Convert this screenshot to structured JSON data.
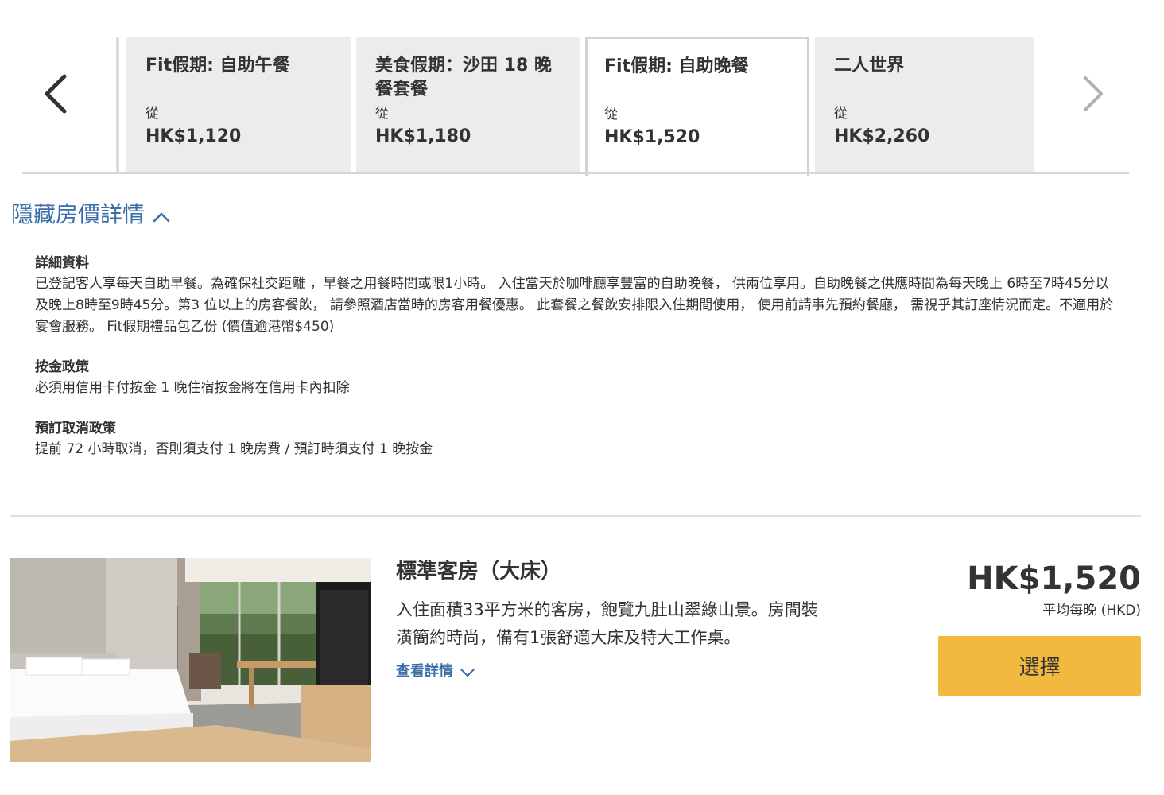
{
  "carousel": {
    "prev_icon": "chevron-left-icon",
    "next_icon": "chevron-right-icon",
    "tabs": [
      {
        "title": "Fit假期: 自助午餐",
        "from": "從",
        "price": "HK$1,120",
        "active": false
      },
      {
        "title": "美食假期：沙田 18 晚餐套餐",
        "from": "從",
        "price": "HK$1,180",
        "active": false
      },
      {
        "title": "Fit假期: 自助晚餐",
        "from": "從",
        "price": "HK$1,520",
        "active": true
      },
      {
        "title": "二人世界",
        "from": "從",
        "price": "HK$2,260",
        "active": false
      }
    ]
  },
  "rate_details": {
    "toggle_label": "隱藏房價詳情",
    "toggle_icon": "chevron-up-icon",
    "blocks": [
      {
        "heading": "詳細資料",
        "text": "已登記客人享每天自助早餐。為確保社交距離 ，早餐之用餐時間或限1小時。 入住當天於咖啡廳享豐富的自助晚餐， 供兩位享用。自助晚餐之供應時間為每天晚上 6時至7時45分以及晚上8時至9時45分。第3 位以上的房客餐飲， 請參照酒店當時的房客用餐優惠。 此套餐之餐飲安排限入住期間使用， 使用前請事先預約餐廳， 需視乎其訂座情況而定。不適用於宴會服務。 Fit假期禮品包乙份 (價值逾港幣$450)"
      },
      {
        "heading": "按金政策",
        "text": "必須用信用卡付按金 1 晚住宿按金將在信用卡內扣除"
      },
      {
        "heading": "預訂取消政策",
        "text": "提前 72 小時取消，否則須支付 1 晚房費 / 預訂時須支付 1 晚按金"
      }
    ]
  },
  "room": {
    "name": "標準客房（大床）",
    "description": "入住面積33平方米的客房，飽覽九肚山翠綠山景。房間裝潢簡約時尚，備有1張舒適大床及特大工作桌。",
    "more_label": "查看詳情",
    "more_icon": "chevron-down-icon",
    "price": "HK$1,520",
    "price_note": "平均每晚 (HKD)",
    "select_label": "選擇",
    "select_color": "#f1b93f",
    "link_color": "#3a6ea8"
  }
}
